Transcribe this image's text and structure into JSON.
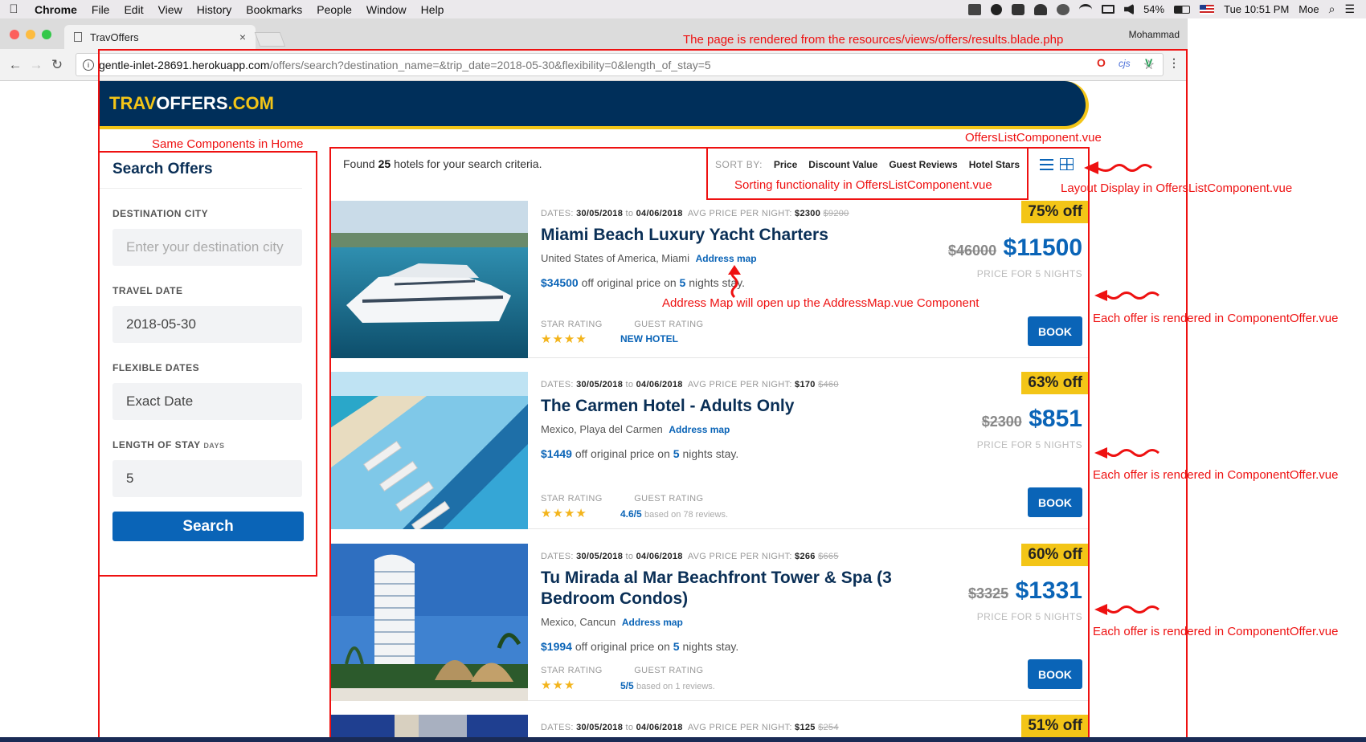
{
  "macmenu": {
    "apple": "",
    "items": [
      "Chrome",
      "File",
      "Edit",
      "View",
      "History",
      "Bookmarks",
      "People",
      "Window",
      "Help"
    ],
    "battery": "54%",
    "clock": "Tue 10:51 PM",
    "user": "Moe"
  },
  "browser": {
    "tab_title": "TravOffers",
    "tab_close": "×",
    "profile": "Mohammad",
    "url_host": "gentle-inlet-28691.herokuapp.com",
    "url_path": "/offers/search?destination_name=&trip_date=2018-05-30&flexibility=0&length_of_stay=5",
    "ext_cjs": "cjs"
  },
  "site": {
    "logo_part1": "TRAV",
    "logo_part2": "OFFERS",
    "logo_part3": ".COM"
  },
  "sidebar": {
    "title": "Search Offers",
    "destination_label": "DESTINATION CITY",
    "destination_placeholder": "Enter your destination city",
    "date_label": "TRAVEL DATE",
    "date_value": "2018-05-30",
    "flex_label": "FLEXIBLE DATES",
    "flex_value": "Exact Date",
    "stay_label": "LENGTH OF STAY",
    "stay_unit": "DAYS",
    "stay_value": "5",
    "search_button": "Search"
  },
  "results": {
    "found_prefix": "Found",
    "found_count": "25",
    "found_suffix": "hotels for your search criteria.",
    "sort_label": "SORT BY:",
    "sort_options": [
      "Price",
      "Discount Value",
      "Guest Reviews",
      "Hotel Stars"
    ]
  },
  "offers": [
    {
      "dates_label": "DATES:",
      "from": "30/05/2018",
      "to_word": "to",
      "to": "04/06/2018",
      "avg_label": "AVG PRICE PER NIGHT:",
      "avg": "$2300",
      "avg_orig": "$9200",
      "title": "Miami Beach Luxury Yacht Charters",
      "location": "United States of America, Miami",
      "map_link": "Address map",
      "save_amount": "$34500",
      "save_text1": "off original price on",
      "nights": "5",
      "save_text2": "nights stay.",
      "star_label": "STAR RATING",
      "guest_label": "GUEST RATING",
      "stars": "★★★★",
      "guest_value": "NEW HOTEL",
      "guest_based": "",
      "discount": "75% off",
      "old_price": "$46000",
      "new_price": "$11500",
      "price_for": "PRICE FOR 5 NIGHTS",
      "book": "BOOK"
    },
    {
      "dates_label": "DATES:",
      "from": "30/05/2018",
      "to_word": "to",
      "to": "04/06/2018",
      "avg_label": "AVG PRICE PER NIGHT:",
      "avg": "$170",
      "avg_orig": "$460",
      "title": "The Carmen Hotel - Adults Only",
      "location": "Mexico, Playa del Carmen",
      "map_link": "Address map",
      "save_amount": "$1449",
      "save_text1": "off original price on",
      "nights": "5",
      "save_text2": "nights stay.",
      "star_label": "STAR RATING",
      "guest_label": "GUEST RATING",
      "stars": "★★★★",
      "guest_value": "4.6/5",
      "guest_based": "based on 78 reviews.",
      "discount": "63% off",
      "old_price": "$2300",
      "new_price": "$851",
      "price_for": "PRICE FOR 5 NIGHTS",
      "book": "BOOK"
    },
    {
      "dates_label": "DATES:",
      "from": "30/05/2018",
      "to_word": "to",
      "to": "04/06/2018",
      "avg_label": "AVG PRICE PER NIGHT:",
      "avg": "$266",
      "avg_orig": "$665",
      "title": "Tu Mirada al Mar Beachfront Tower & Spa (3 Bedroom Condos)",
      "location": "Mexico, Cancun",
      "map_link": "Address map",
      "save_amount": "$1994",
      "save_text1": "off original price on",
      "nights": "5",
      "save_text2": "nights stay.",
      "star_label": "STAR RATING",
      "guest_label": "GUEST RATING",
      "stars": "★★★",
      "guest_value": "5/5",
      "guest_based": "based on 1 reviews.",
      "discount": "60% off",
      "old_price": "$3325",
      "new_price": "$1331",
      "price_for": "PRICE FOR 5 NIGHTS",
      "book": "BOOK"
    },
    {
      "dates_label": "DATES:",
      "from": "30/05/2018",
      "to_word": "to",
      "to": "04/06/2018",
      "avg_label": "AVG PRICE PER NIGHT:",
      "avg": "$125",
      "avg_orig": "$254",
      "discount": "51% off"
    }
  ],
  "annotations": {
    "page_rendered": "The page is rendered from the resources/views/offers/results.blade.php",
    "same_components": "Same Components in Home",
    "offers_list": "OffersListComponent.vue",
    "sorting": "Sorting functionality in OffersListComponent.vue",
    "layout_display": "Layout Display in OffersListComponent.vue",
    "address_map": "Address Map will open up the AddressMap.vue Component",
    "each_offer": "Each offer is rendered in ComponentOffer.vue"
  },
  "colors": {
    "brand_navy": "#002f5a",
    "brand_yellow": "#f3c517",
    "accent_blue": "#0a64b7",
    "annotation_red": "#ee1111"
  }
}
